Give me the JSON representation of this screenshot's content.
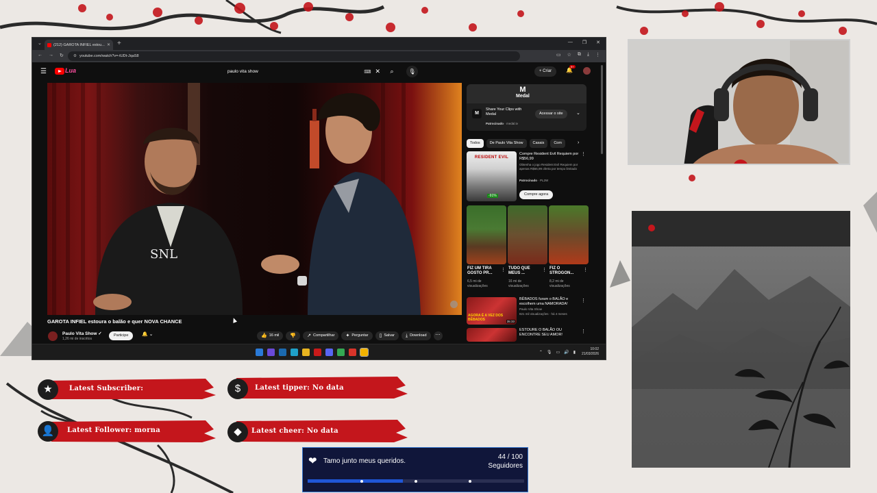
{
  "overlay": {
    "latest_subscriber": "Latest Subscriber:",
    "latest_tipper": "Latest tipper: No data",
    "latest_follower": "Latest Follower: morna",
    "latest_cheer": "Latest cheer: No data",
    "goal": {
      "title": "Tamo junto meus queridos.",
      "count": "44 / 100",
      "unit": "Seguidores",
      "progress": 0.44,
      "milestones": [
        0.25,
        0.5,
        0.75
      ]
    },
    "colors": {
      "stripe_red": "#c4161c",
      "goal_bg": "#10163a",
      "goal_fill": "#1f56d6"
    }
  },
  "browser": {
    "tab_title": "(212) GAROTA INFIEL estou...",
    "url": "youtube.com/watch?v=-tUDt-JqaS8"
  },
  "youtube": {
    "logo_text": "Lua",
    "search_query": "paulo vita show",
    "create_label": "Criar",
    "notif_badge": "9+",
    "video_title": "GAROTA INFIEL estoura o balão e quer NOVA CHANCE",
    "channel_name": "Paulo Vita Show",
    "channel_subs": "1,26 mi de inscritos",
    "join_label": "Participe",
    "likes": "16 mil",
    "share_label": "Compartilhar",
    "ask_label": "Perguntar",
    "save_label": "Salvar",
    "download_label": "Download",
    "ad": {
      "brand": "Medal",
      "text": "Share Your Clips with Medal",
      "sponsored": "Patrocinado",
      "domain": "medal.tv",
      "cta": "Acessar o site"
    },
    "chips": [
      "Todos",
      "De Paulo Vita Show",
      "Casais",
      "Com"
    ],
    "promo": {
      "thumb_text": "RESIDENT EVIL",
      "badge": "-91%",
      "title": "Compre Resident Evil Requiem por R$56,99",
      "desc": "Obtenha o jogo Resident Evil Requiem por apenas R$56,99 oferta por tempo limitado",
      "sponsored": "Patrocinado",
      "advertiser": "PL2W",
      "cta": "Compre agora"
    },
    "shorts": [
      {
        "title": "FIZ UM TIRA GOSTO PR...",
        "views": "6,5 mi de visualizações"
      },
      {
        "title": "TUDO QUE MEUS ...",
        "views": "16 mi de visualizações"
      },
      {
        "title": "FIZ O STROGON...",
        "views": "8,2 mi de visualizações"
      }
    ],
    "recs": [
      {
        "title": "BÊBADOS furam o BALÃO e escolhem uma NAMORADA!",
        "channel": "Paulo Vita Show",
        "meta": "821 mil visualizações · há 4 meses",
        "thumb_caption": "AGORA É A VEZ DOS BÊBADOS",
        "duration": "35:33"
      },
      {
        "title": "ESTOURE O BALÃO OU ENCONTRE SEU AMOR!",
        "channel": "Paulo Vita Show",
        "meta": "",
        "thumb_caption": "",
        "duration": ""
      }
    ]
  },
  "taskbar": {
    "time": "10:02",
    "date": "21/03/2026"
  }
}
